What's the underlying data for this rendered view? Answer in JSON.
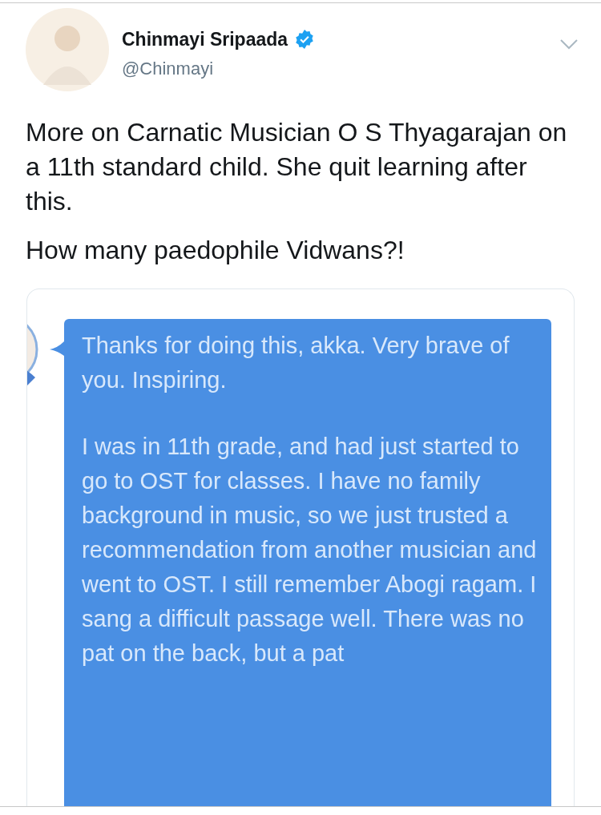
{
  "author": {
    "name": "Chinmayi Sripaada",
    "verified": true,
    "handle": "@Chinmayi"
  },
  "tweet_text": [
    "More on Carnatic Musician O S Thyagarajan on a 11th standard child. She quit learning after this.",
    "How many paedophile Vidwans?!"
  ],
  "attached_image": {
    "message_paragraphs": [
      "Thanks for doing this, akka. Very brave of you. Inspiring.",
      "I was in 11th grade, and had just started to go to OST for classes. I have no family background in music, so we just trusted a recommendation from another musician and went to OST. I still remember Abogi ragam. I sang a difficult passage well. There was no pat on the back, but a pat"
    ]
  }
}
